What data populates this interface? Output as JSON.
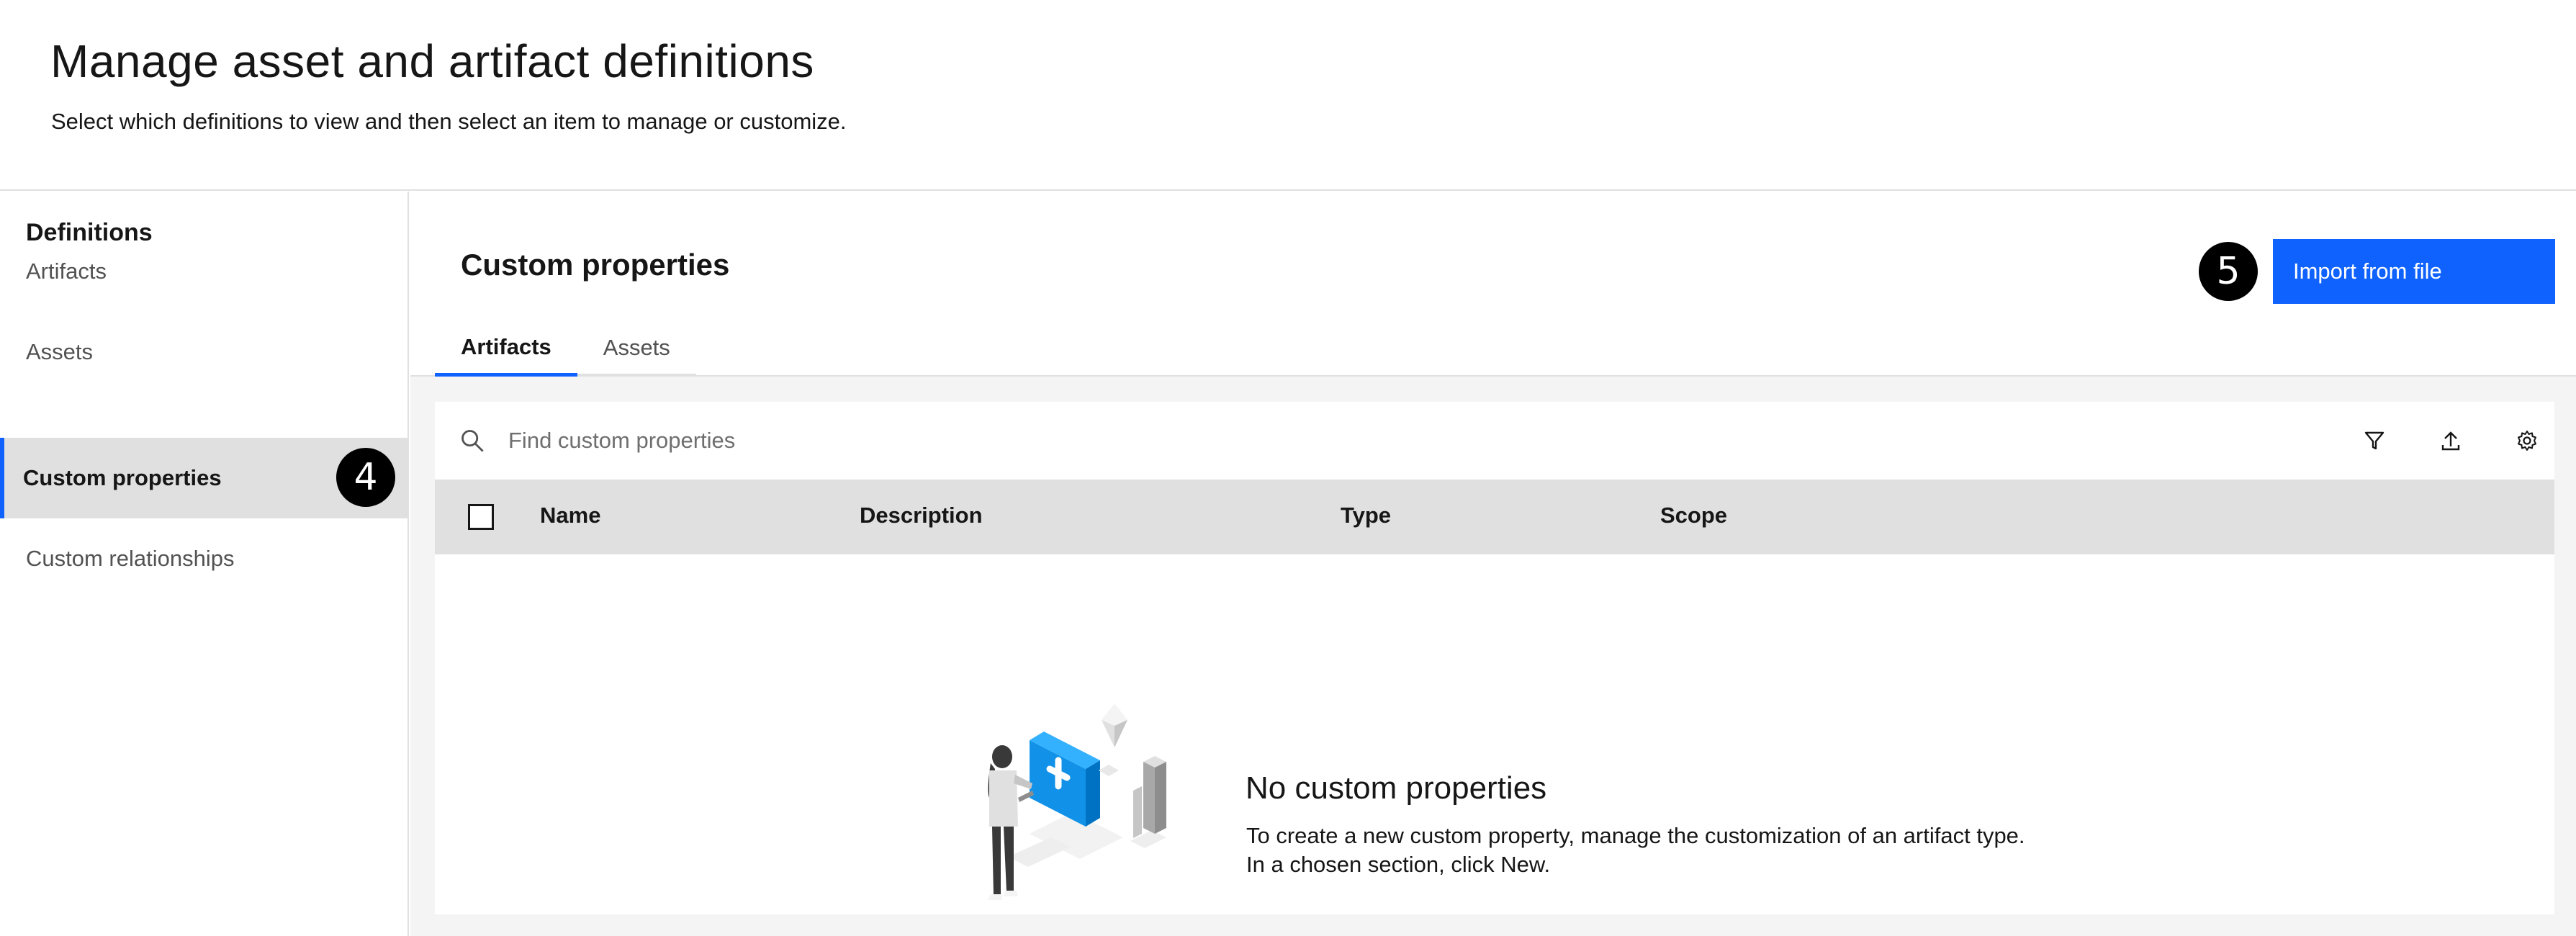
{
  "header": {
    "title": "Manage asset and artifact definitions",
    "subtitle": "Select which definitions to view and then select an item to manage or customize."
  },
  "sidebar": {
    "heading": "Definitions",
    "items": [
      {
        "label": "Artifacts",
        "active": false
      },
      {
        "label": "Assets",
        "active": false
      },
      {
        "label": "Custom properties",
        "active": true
      },
      {
        "label": "Custom relationships",
        "active": false
      }
    ]
  },
  "markers": {
    "sidebar_marker": "4",
    "import_marker": "5"
  },
  "main": {
    "section_title": "Custom properties",
    "import_button": "Import from file",
    "tabs": [
      {
        "label": "Artifacts",
        "active": true
      },
      {
        "label": "Assets",
        "active": false
      }
    ],
    "search": {
      "placeholder": "Find custom properties",
      "value": ""
    },
    "toolbar_icons": [
      "filter-icon",
      "upload-icon",
      "settings-icon"
    ],
    "table": {
      "columns": [
        "Name",
        "Description",
        "Type",
        "Scope"
      ]
    },
    "empty_state": {
      "title": "No custom properties",
      "description": "To create a new custom property, manage the customization of an artifact type. In a chosen section, click New."
    }
  },
  "colors": {
    "primary": "#0f62fe",
    "header_row": "#e0e0e0",
    "background": "#f4f4f4",
    "text": "#161616",
    "muted_text": "#525252"
  }
}
